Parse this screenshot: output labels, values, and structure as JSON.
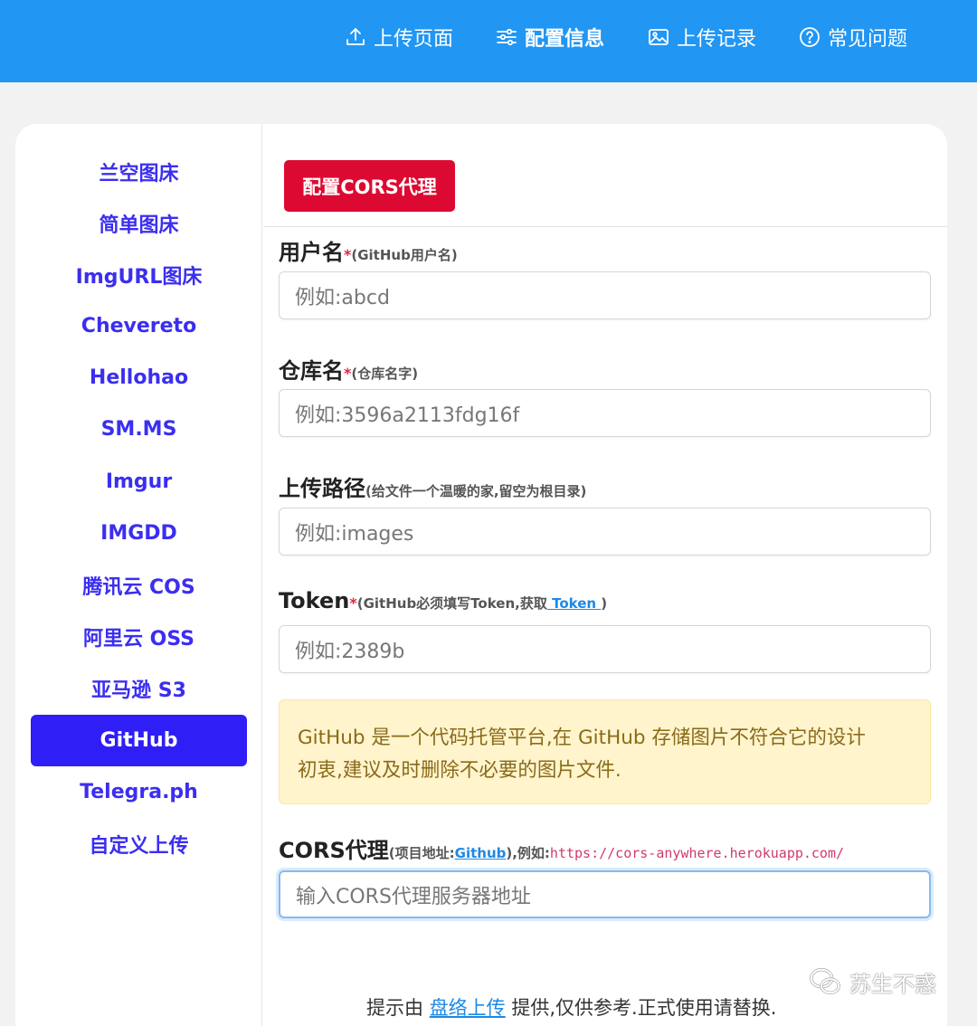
{
  "nav": {
    "items": [
      {
        "label": "上传页面",
        "icon": "upload-icon"
      },
      {
        "label": "配置信息",
        "icon": "sliders-icon",
        "active": true
      },
      {
        "label": "上传记录",
        "icon": "image-icon"
      },
      {
        "label": "常见问题",
        "icon": "help-circle-icon"
      }
    ]
  },
  "sidebar": {
    "items": [
      {
        "label": "兰空图床"
      },
      {
        "label": "简单图床"
      },
      {
        "label": "ImgURL图床"
      },
      {
        "label": "Chevereto"
      },
      {
        "label": "Hellohao"
      },
      {
        "label": "SM.MS"
      },
      {
        "label": "Imgur"
      },
      {
        "label": "IMGDD"
      },
      {
        "label": "腾讯云 COS"
      },
      {
        "label": "阿里云 OSS"
      },
      {
        "label": "亚马逊 S3"
      },
      {
        "label": "GitHub",
        "active": true
      },
      {
        "label": "Telegra.ph"
      },
      {
        "label": "自定义上传"
      }
    ]
  },
  "main": {
    "cors_button": "配置CORS代理",
    "fields": [
      {
        "label": "用户名",
        "required": "*",
        "hint": "(GitHub用户名)",
        "placeholder": "例如:abcd"
      },
      {
        "label": "仓库名",
        "required": "*",
        "hint": "(仓库名字)",
        "placeholder": "例如:3596a2113fdg16f"
      },
      {
        "label": "上传路径",
        "required": "",
        "hint": "(给文件一个温暖的家,留空为根目录)",
        "placeholder": "例如:images"
      },
      {
        "label": "Token",
        "required": "*",
        "hint_before": "(GitHub必须填写Token,获取",
        "hint_link": " Token ",
        "hint_after": ")",
        "placeholder": "例如:2389b"
      }
    ],
    "alert_line1": "GitHub 是一个代码托管平台,在 GitHub 存储图片不符合它的设计",
    "alert_line2": "初衷,建议及时删除不必要的图片文件.",
    "cors": {
      "label": "CORS代理",
      "hint_before": "(项目地址:",
      "hint_link": "Github",
      "hint_middle": "),例如:",
      "example_url": "https://cors-anywhere.herokuapp.com/",
      "placeholder": "输入CORS代理服务器地址"
    }
  },
  "footer": {
    "before": "提示由 ",
    "link": "盘络上传",
    "after": " 提供,仅供参考.正式使用请替换."
  },
  "watermark": {
    "text": "苏生不惑"
  }
}
